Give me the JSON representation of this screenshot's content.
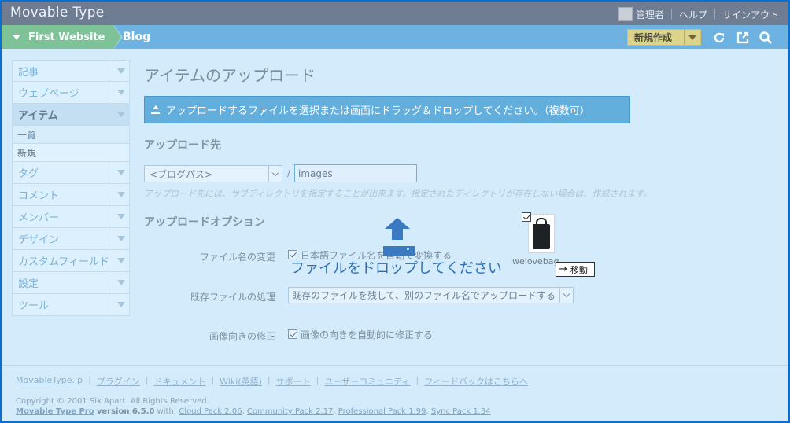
{
  "header": {
    "app_title": "Movable Type",
    "user_name": "管理者",
    "help": "ヘルプ",
    "signout": "サインアウト"
  },
  "nav": {
    "site": "First Website",
    "blog": "Blog",
    "new_button": "新規作成",
    "icons": [
      "refresh-icon",
      "external-link-icon",
      "search-icon"
    ]
  },
  "sidebar": {
    "items": [
      {
        "label": "記事"
      },
      {
        "label": "ウェブページ"
      },
      {
        "label": "アイテム",
        "active": true
      },
      {
        "label": "タグ"
      },
      {
        "label": "コメント"
      },
      {
        "label": "メンバー"
      },
      {
        "label": "デザイン"
      },
      {
        "label": "カスタムフィールド"
      },
      {
        "label": "設定"
      },
      {
        "label": "ツール"
      }
    ],
    "subitems": [
      {
        "label": "一覧"
      },
      {
        "label": "新規",
        "current": true
      }
    ]
  },
  "main": {
    "page_title": "アイテムのアップロード",
    "dropzone_text": "アップロードするファイルを選択または画面にドラッグ＆ドロップしてください。（複数可）",
    "dest_heading": "アップロード先",
    "path_select": "<ブログパス>",
    "path_sep": "/",
    "dir_value": "images",
    "dest_hint": "アップロード先には、サブディレクトリを指定することが出来ます。指定されたディレクトリが存在しない場合は、作成されます。",
    "options_heading": "アップロードオプション",
    "rename_label": "ファイル名の変更",
    "rename_option": "日本語ファイル名を自動で変換する",
    "duplicate_label": "既存ファイルの処理",
    "duplicate_option": "既存のファイルを残して、別のファイル名でアップロードする",
    "orientation_label": "画像向きの修正",
    "orientation_option": "画像の向きを自動的に修正する",
    "drop_overlay_text": "ファイルをドロップしてください",
    "dragged_file_name": "welovebag",
    "move_tooltip": "移動"
  },
  "footer": {
    "links": [
      "MovableType.jp",
      "プラグイン",
      "ドキュメント",
      "Wiki(英語)",
      "サポート",
      "ユーザーコミュニティ",
      "フィードバックはこちらへ"
    ],
    "copyright": "Copyright © 2001 Six Apart. All Rights Reserved.",
    "product": "Movable Type Pro",
    "version_text": "version 6.5.0",
    "with_text": "with:",
    "packs": [
      "Cloud Pack 2.06",
      "Community Pack 2.17",
      "Professional Pack 1.99",
      "Sync Pack 1.34"
    ]
  },
  "colors": {
    "window_border": "#0a6fd0",
    "header_bg": "#6f7d93",
    "nav_bg": "#6db2e0",
    "site_tab": "#7ec397",
    "new_button": "#dcd48a",
    "dropzone": "#62aedc",
    "drop_arrow": "#3b7ac1"
  }
}
